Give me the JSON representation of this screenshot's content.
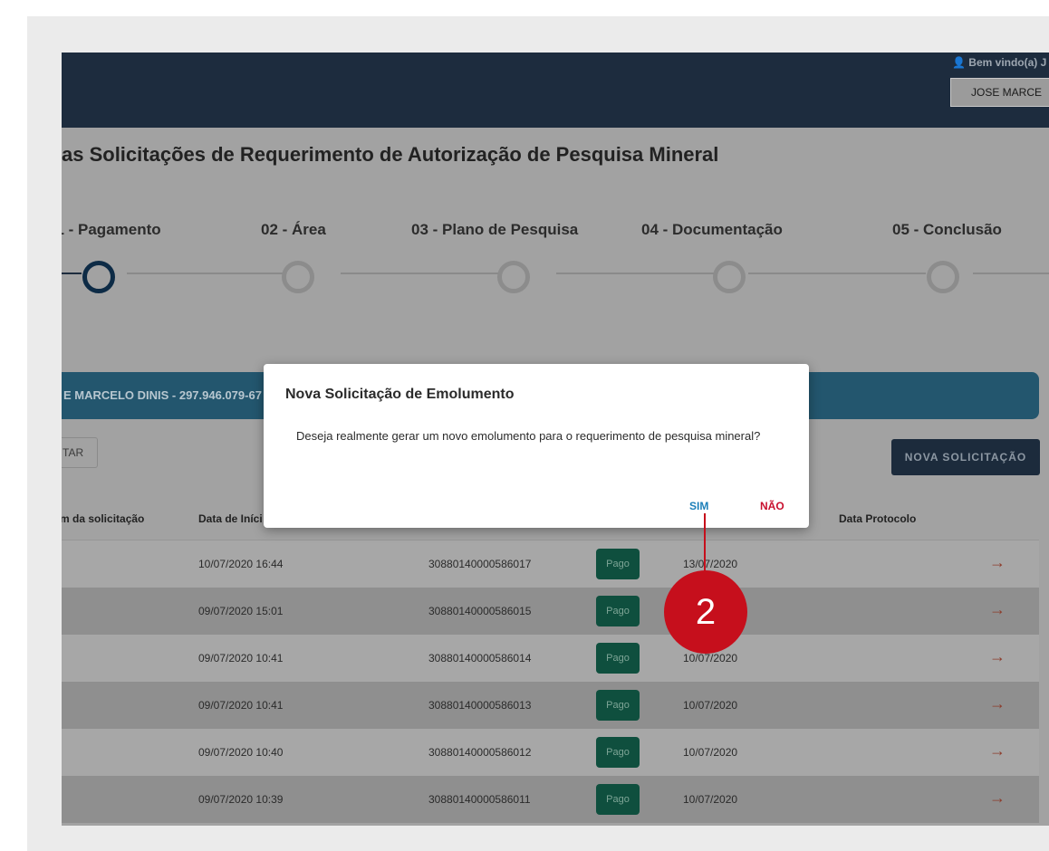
{
  "header": {
    "welcome": "Bem vindo(a) J",
    "user_button": "JOSE MARCE"
  },
  "page": {
    "title": "as Solicitações de Requerimento de Autorização de Pesquisa Mineral"
  },
  "steps": [
    {
      "label": "01 - Pagamento",
      "active": true
    },
    {
      "label": "02 - Área",
      "active": false
    },
    {
      "label": "03 - Plano de Pesquisa",
      "active": false
    },
    {
      "label": "04 - Documentação",
      "active": false
    },
    {
      "label": "05 - Conclusão",
      "active": false
    }
  ],
  "banner": {
    "text": "E MARCELO DINIS - 297.946.079-67"
  },
  "toolbar": {
    "filter_label": "TAR",
    "new_request_label": "NOVA SOLICITAÇÃO"
  },
  "table": {
    "headers": [
      "m da solicitação",
      "Data de Iníci",
      "Data Protocolo"
    ],
    "rows": [
      {
        "start": "10/07/2020 16:44",
        "number": "30880140000586017",
        "status": "Pago",
        "payment_date": "13/07/2020"
      },
      {
        "start": "09/07/2020 15:01",
        "number": "30880140000586015",
        "status": "Pago",
        "payment_date": ""
      },
      {
        "start": "09/07/2020 10:41",
        "number": "30880140000586014",
        "status": "Pago",
        "payment_date": "10/07/2020"
      },
      {
        "start": "09/07/2020 10:41",
        "number": "30880140000586013",
        "status": "Pago",
        "payment_date": "10/07/2020"
      },
      {
        "start": "09/07/2020 10:40",
        "number": "30880140000586012",
        "status": "Pago",
        "payment_date": "10/07/2020"
      },
      {
        "start": "09/07/2020 10:39",
        "number": "30880140000586011",
        "status": "Pago",
        "payment_date": "10/07/2020"
      }
    ],
    "arrow_icon": "arrow-right-icon"
  },
  "modal": {
    "title": "Nova Solicitação de Emolumento",
    "body": "Deseja realmente gerar um novo emolumento para o requerimento de pesquisa mineral?",
    "yes_label": "SIM",
    "no_label": "NÃO"
  },
  "callout": {
    "number": "2"
  },
  "colors": {
    "topbar": "#1d2c3e",
    "badge": "#0f4f3e",
    "yes": "#1c7fb9",
    "no": "#c8102e",
    "callout": "#c60f1c"
  }
}
